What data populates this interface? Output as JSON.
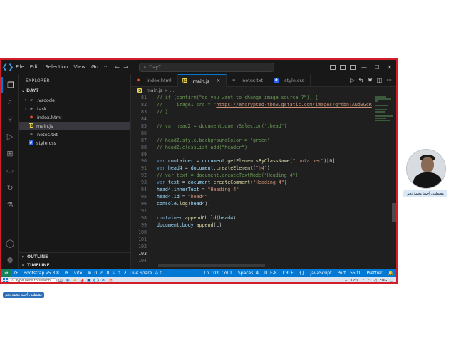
{
  "window": {
    "menu": [
      "File",
      "Edit",
      "Selection",
      "View",
      "Go"
    ],
    "search_placeholder": "Day7"
  },
  "explorer": {
    "title": "EXPLORER",
    "folder": "DAY7",
    "items": [
      {
        "label": ".vscode",
        "type": "folder",
        "icon": "folder-icon"
      },
      {
        "label": "task",
        "type": "folder",
        "icon": "folder-icon"
      },
      {
        "label": "index.html",
        "type": "html",
        "icon": "html-file-icon"
      },
      {
        "label": "main.js",
        "type": "js",
        "icon": "js-file-icon",
        "selected": true
      },
      {
        "label": "notes.txt",
        "type": "txt",
        "icon": "text-file-icon"
      },
      {
        "label": "style.css",
        "type": "css",
        "icon": "css-file-icon"
      }
    ],
    "sections": [
      "OUTLINE",
      "TIMELINE"
    ]
  },
  "tabs": [
    {
      "label": "index.html",
      "active": false
    },
    {
      "label": "main.js",
      "active": true
    },
    {
      "label": "notes.txt",
      "active": false
    },
    {
      "label": "style.css",
      "active": false
    }
  ],
  "breadcrumb": {
    "file": "main.js",
    "sep": ">",
    "more": "..."
  },
  "editor": {
    "lines": [
      {
        "n": "81",
        "html": "<span class=\"c-cm\">// if (confirm(\"do you want to change image source ?\")) {</span>"
      },
      {
        "n": "82",
        "html": "<span class=\"c-cm\">//     image1.src = \"<span class=\"c-link\">https://encrypted-tbn0.gstatic.com/images?q=tbn:ANd9GcR</span></span>"
      },
      {
        "n": "83",
        "html": "<span class=\"c-cm\">// }</span>"
      },
      {
        "n": "84",
        "html": ""
      },
      {
        "n": "85",
        "html": "<span class=\"c-cm\">// var head2 = document.querySelector(\".head\")</span>"
      },
      {
        "n": "86",
        "html": ""
      },
      {
        "n": "87",
        "html": "<span class=\"c-cm\">// head2.style.backgroundColor = \"green\"</span>"
      },
      {
        "n": "88",
        "html": "<span class=\"c-cm\">// head2.classList.add(\"header\")</span>"
      },
      {
        "n": "89",
        "html": ""
      },
      {
        "n": "90",
        "html": "<span class=\"c-kw\">var</span> <span class=\"c-var\">container</span> = <span class=\"c-var\">document</span>.<span class=\"c-fn\">getElementsByClassName</span>(<span class=\"c-str\">\"container\"</span>)[<span class=\"c-num\">0</span>]"
      },
      {
        "n": "91",
        "html": "<span class=\"c-kw\">var</span> <span class=\"c-var\">head4</span> = <span class=\"c-var\">document</span>.<span class=\"c-fn\">createElement</span>(<span class=\"c-str\">\"h4\"</span>)"
      },
      {
        "n": "92",
        "html": "<span class=\"c-cm\">// var text = document.createTextNode(\"Heading 4\")</span>"
      },
      {
        "n": "93",
        "html": "<span class=\"c-kw\">var</span> <span class=\"c-var\">text</span> = <span class=\"c-var\">document</span>.<span class=\"c-fn\">createComment</span>(<span class=\"c-str\">\"Heading 4\"</span>)"
      },
      {
        "n": "94",
        "html": "<span class=\"c-var\">head4</span>.<span class=\"c-var\">innerText</span> = <span class=\"c-str\">\"Heading 4\"</span>"
      },
      {
        "n": "95",
        "html": "<span class=\"c-var\">head4</span>.<span class=\"c-var\">id</span> = <span class=\"c-str\">\"head4\"</span>"
      },
      {
        "n": "96",
        "html": "<span class=\"c-var\">console</span>.<span class=\"c-fn\">log</span>(<span class=\"c-var\">head4</span>);"
      },
      {
        "n": "97",
        "html": ""
      },
      {
        "n": "98",
        "html": "<span class=\"c-var\">container</span>.<span class=\"c-fn\">appendChild</span>(<span class=\"c-var\">head4</span>)"
      },
      {
        "n": "99",
        "html": "<span class=\"c-var\">document</span>.<span class=\"c-var\">body</span>.<span class=\"c-fn\">append</span>(<span class=\"c-var\">c</span>)"
      },
      {
        "n": "100",
        "html": ""
      },
      {
        "n": "101",
        "html": ""
      },
      {
        "n": "102",
        "html": ""
      },
      {
        "n": "103",
        "html": "",
        "current": true
      },
      {
        "n": "104",
        "html": ""
      }
    ]
  },
  "statusbar": {
    "branch": "Bootstrap v5.3.8",
    "vite": "vite",
    "errors": "0",
    "warnings": "0",
    "ports": "0",
    "live_share": "Live Share",
    "cursor": "Ln 103, Col 1",
    "spaces": "Spaces: 4",
    "encoding": "UTF-8",
    "eol": "CRLF",
    "braces": "{}",
    "language": "JavaScript",
    "port": "Port : 5501",
    "prettier": "Prettier"
  },
  "taskbar": {
    "search_placeholder": "Type here to search",
    "weather": "12°C",
    "lang": "ENG"
  },
  "webcam": {
    "name_label": "مصطفى أحمد محمد نجم"
  },
  "footer_name": "مصطفى أحمد محمد نجم",
  "colors": {
    "window_border": "#d01f2a",
    "statusbar": "#0078d4",
    "accent": "#0078d4"
  }
}
